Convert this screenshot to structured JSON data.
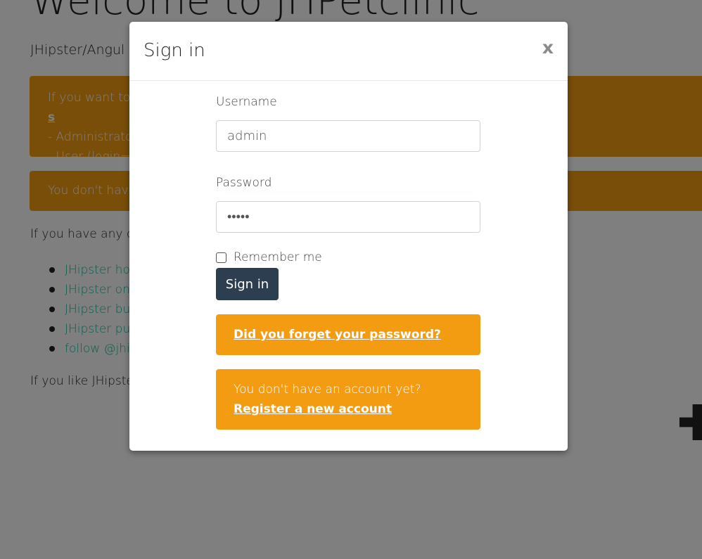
{
  "background": {
    "title": "Welcome to JHPetclinic",
    "subtitle": "JHipster/Angul",
    "alert1": {
      "line1_prefix": "If you want to ",
      "line1_link": "s",
      "line2": "- Administrator",
      "line3": "- User (login=\""
    },
    "alert2": "You don't have",
    "questions": "If you have any qu",
    "links": [
      "JHipster hor",
      "JHipster on",
      "JHipster bug",
      "JHipster pub",
      "follow @jhip"
    ],
    "like_text": "If you like JHipster,"
  },
  "modal": {
    "title": "Sign in",
    "close_label": "x",
    "username_label": "Username",
    "username_value": "admin",
    "password_label": "Password",
    "password_value": "admin",
    "remember_label": "Remember me",
    "submit_label": "Sign in",
    "forgot_link": "Did you forget your password?",
    "register_prefix": "You don't have an account yet? ",
    "register_link": "Register a new account"
  },
  "colors": {
    "warning": "#f39c12",
    "primary": "#2c3e50",
    "link": "#18bc9c"
  }
}
